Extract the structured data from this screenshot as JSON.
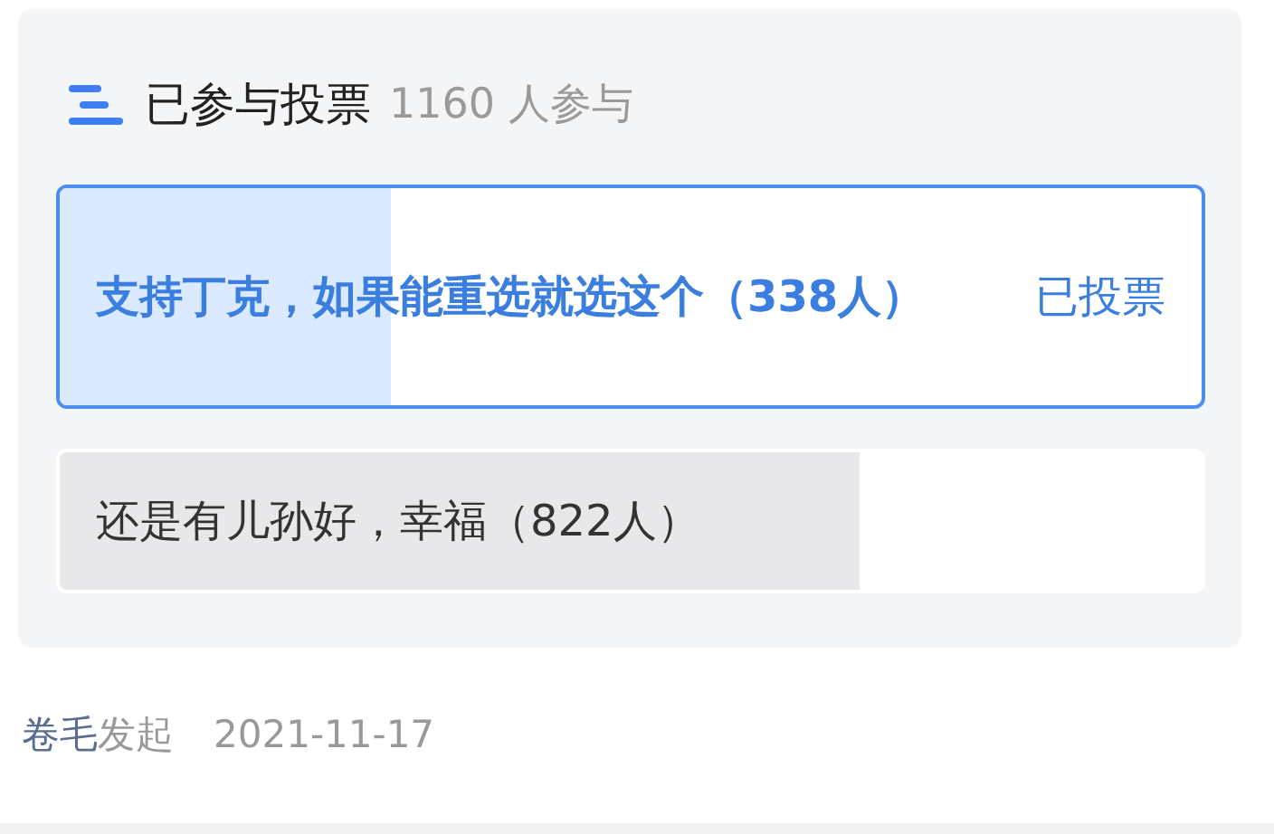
{
  "poll": {
    "title": "已参与投票",
    "participants": "1160 人参与",
    "options": [
      {
        "text": "支持丁克，如果能重选就选这个（338人）",
        "level": 0.29,
        "selected": true,
        "status": "已投票"
      },
      {
        "text": "还是有儿孙好，幸福（822人）",
        "level": 0.7,
        "selected": false
      }
    ]
  },
  "footer": {
    "author": "卷毛",
    "action": "发起",
    "date": "2021-11-17"
  }
}
